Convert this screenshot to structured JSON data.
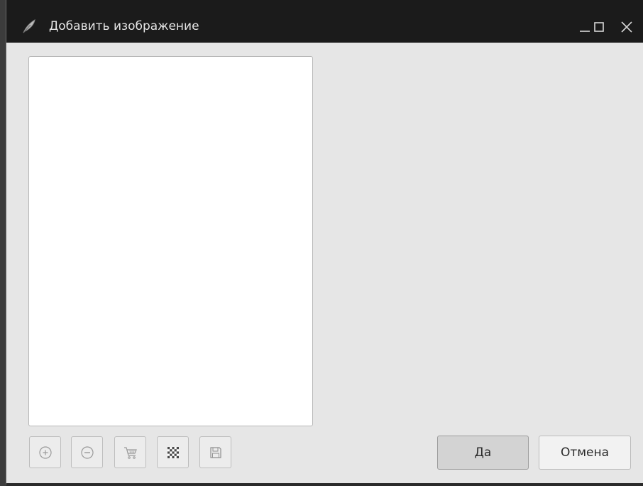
{
  "window": {
    "title": "Добавить изображение"
  },
  "titlebar_buttons": {
    "minimize_icon": "minimize-icon",
    "maximize_icon": "maximize-icon",
    "close_icon": "close-icon"
  },
  "toolbar": {
    "icons": [
      "add-icon",
      "remove-icon",
      "cart-icon",
      "checkerboard-icon",
      "save-icon"
    ]
  },
  "dialog_buttons": {
    "ok_label": "Да",
    "cancel_label": "Отмена"
  },
  "colors": {
    "titlebar": "#1b1b1b",
    "window_bg": "#e6e6e6",
    "list_bg": "#ffffff",
    "ok_button": "#d3d3d3"
  }
}
